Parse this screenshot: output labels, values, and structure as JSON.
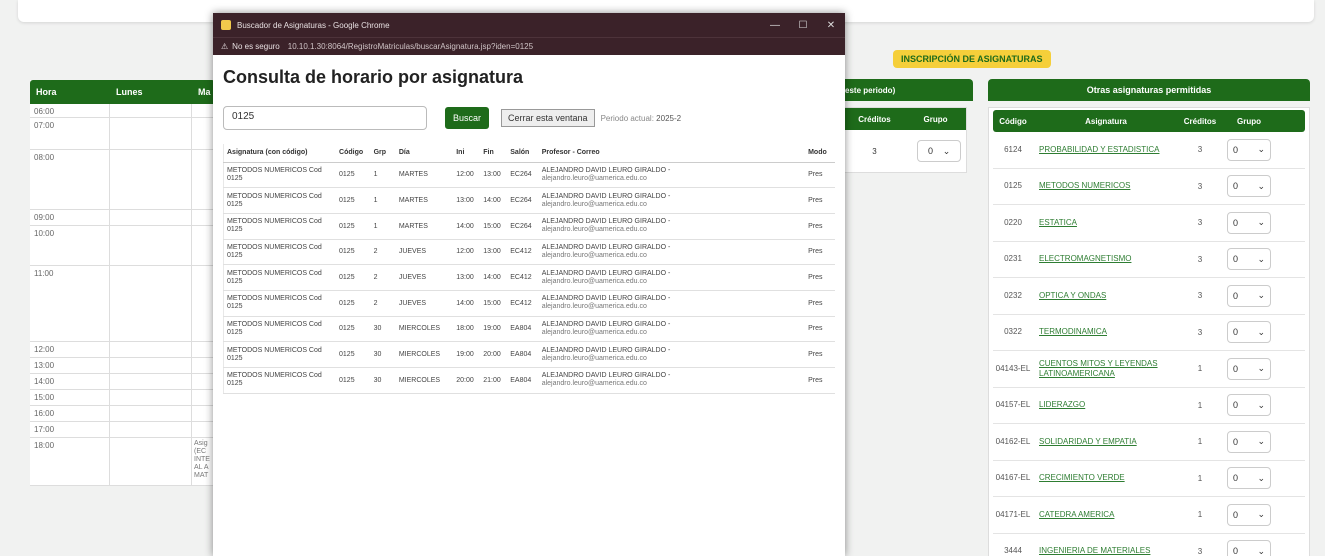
{
  "badge": "INSCRIPCIÓN DE ASIGNATURAS",
  "schedule": {
    "headers": [
      "Hora",
      "Lunes",
      "Ma"
    ],
    "hours": [
      "06:00",
      "07:00",
      "08:00",
      "09:00",
      "10:00",
      "11:00",
      "12:00",
      "13:00",
      "14:00",
      "15:00",
      "16:00",
      "17:00",
      "18:00"
    ],
    "cell_text": [
      "Asig",
      "(EC",
      "INTE",
      "AL A",
      "MAT"
    ]
  },
  "current": {
    "header": "este periodo)",
    "col_creditos": "Créditos",
    "col_grupo": "Grupo",
    "creditos": "3",
    "grupo": "0"
  },
  "other": {
    "header": "Otras asignaturas permitidas",
    "cols": [
      "Código",
      "Asignatura",
      "Créditos",
      "Grupo"
    ],
    "rows": [
      {
        "codigo": "6124",
        "nombre": "PROBABILIDAD Y ESTADISTICA",
        "creditos": "3",
        "grupo": "0"
      },
      {
        "codigo": "0125",
        "nombre": "METODOS NUMERICOS",
        "creditos": "3",
        "grupo": "0"
      },
      {
        "codigo": "0220",
        "nombre": "ESTATICA",
        "creditos": "3",
        "grupo": "0"
      },
      {
        "codigo": "0231",
        "nombre": "ELECTROMAGNETISMO",
        "creditos": "3",
        "grupo": "0"
      },
      {
        "codigo": "0232",
        "nombre": "OPTICA Y ONDAS",
        "creditos": "3",
        "grupo": "0"
      },
      {
        "codigo": "0322",
        "nombre": "TERMODINAMICA",
        "creditos": "3",
        "grupo": "0"
      },
      {
        "codigo": "04143-EL",
        "nombre": "CUENTOS MITOS Y LEYENDAS LATINOAMERICANA",
        "creditos": "1",
        "grupo": "0"
      },
      {
        "codigo": "04157-EL",
        "nombre": "LIDERAZGO",
        "creditos": "1",
        "grupo": "0"
      },
      {
        "codigo": "04162-EL",
        "nombre": "SOLIDARIDAD Y EMPATIA",
        "creditos": "1",
        "grupo": "0"
      },
      {
        "codigo": "04167-EL",
        "nombre": "CRECIMIENTO VERDE",
        "creditos": "1",
        "grupo": "0"
      },
      {
        "codigo": "04171-EL",
        "nombre": "CATEDRA AMERICA",
        "creditos": "1",
        "grupo": "0"
      },
      {
        "codigo": "3444",
        "nombre": "INGENIERIA DE MATERIALES",
        "creditos": "3",
        "grupo": "0"
      }
    ]
  },
  "popup": {
    "window_title": "Buscador de Asignaturas - Google Chrome",
    "not_secure": "No es seguro",
    "url": "10.10.1.30:8064/RegistroMatriculas/buscarAsignatura.jsp?iden=0125",
    "heading": "Consulta de horario por asignatura",
    "search_value": "0125",
    "buscar_label": "Buscar",
    "cerrar_label": "Cerrar esta ventana",
    "periodo_label": "Periodo actual:",
    "periodo_value": "2025-2",
    "columns": [
      "Asignatura (con código)",
      "Código",
      "Grp",
      "Día",
      "Ini",
      "Fin",
      "Salón",
      "Profesor - Correo",
      "Modo"
    ],
    "rows": [
      {
        "asig": "METODOS NUMERICOS Cod 0125",
        "cod": "0125",
        "grp": "1",
        "dia": "MARTES",
        "ini": "12:00",
        "fin": "13:00",
        "salon": "EC264",
        "prof": "ALEJANDRO DAVID LEURO GIRALDO -",
        "mail": "alejandro.leuro@uamerica.edu.co",
        "modo": "Pres"
      },
      {
        "asig": "METODOS NUMERICOS Cod 0125",
        "cod": "0125",
        "grp": "1",
        "dia": "MARTES",
        "ini": "13:00",
        "fin": "14:00",
        "salon": "EC264",
        "prof": "ALEJANDRO DAVID LEURO GIRALDO -",
        "mail": "alejandro.leuro@uamerica.edu.co",
        "modo": "Pres"
      },
      {
        "asig": "METODOS NUMERICOS Cod 0125",
        "cod": "0125",
        "grp": "1",
        "dia": "MARTES",
        "ini": "14:00",
        "fin": "15:00",
        "salon": "EC264",
        "prof": "ALEJANDRO DAVID LEURO GIRALDO -",
        "mail": "alejandro.leuro@uamerica.edu.co",
        "modo": "Pres"
      },
      {
        "asig": "METODOS NUMERICOS Cod 0125",
        "cod": "0125",
        "grp": "2",
        "dia": "JUEVES",
        "ini": "12:00",
        "fin": "13:00",
        "salon": "EC412",
        "prof": "ALEJANDRO DAVID LEURO GIRALDO -",
        "mail": "alejandro.leuro@uamerica.edu.co",
        "modo": "Pres"
      },
      {
        "asig": "METODOS NUMERICOS Cod 0125",
        "cod": "0125",
        "grp": "2",
        "dia": "JUEVES",
        "ini": "13:00",
        "fin": "14:00",
        "salon": "EC412",
        "prof": "ALEJANDRO DAVID LEURO GIRALDO -",
        "mail": "alejandro.leuro@uamerica.edu.co",
        "modo": "Pres"
      },
      {
        "asig": "METODOS NUMERICOS Cod 0125",
        "cod": "0125",
        "grp": "2",
        "dia": "JUEVES",
        "ini": "14:00",
        "fin": "15:00",
        "salon": "EC412",
        "prof": "ALEJANDRO DAVID LEURO GIRALDO -",
        "mail": "alejandro.leuro@uamerica.edu.co",
        "modo": "Pres"
      },
      {
        "asig": "METODOS NUMERICOS Cod 0125",
        "cod": "0125",
        "grp": "30",
        "dia": "MIERCOLES",
        "ini": "18:00",
        "fin": "19:00",
        "salon": "EA804",
        "prof": "ALEJANDRO DAVID LEURO GIRALDO -",
        "mail": "alejandro.leuro@uamerica.edu.co",
        "modo": "Pres"
      },
      {
        "asig": "METODOS NUMERICOS Cod 0125",
        "cod": "0125",
        "grp": "30",
        "dia": "MIERCOLES",
        "ini": "19:00",
        "fin": "20:00",
        "salon": "EA804",
        "prof": "ALEJANDRO DAVID LEURO GIRALDO -",
        "mail": "alejandro.leuro@uamerica.edu.co",
        "modo": "Pres"
      },
      {
        "asig": "METODOS NUMERICOS Cod 0125",
        "cod": "0125",
        "grp": "30",
        "dia": "MIERCOLES",
        "ini": "20:00",
        "fin": "21:00",
        "salon": "EA804",
        "prof": "ALEJANDRO DAVID LEURO GIRALDO -",
        "mail": "alejandro.leuro@uamerica.edu.co",
        "modo": "Pres"
      }
    ]
  },
  "colors": {
    "brand_green": "#1e6b1a",
    "badge_yellow": "#f5cf3a",
    "titlebar": "#3b2229"
  }
}
